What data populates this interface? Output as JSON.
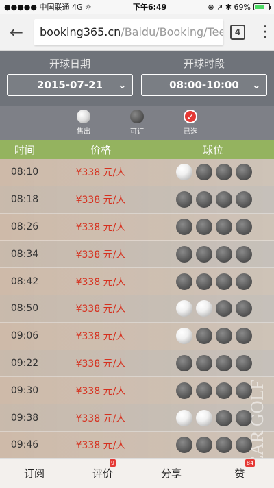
{
  "status": {
    "carrier": "●●●●● 中国联通  4G  ☼",
    "time": "下午6:49",
    "right": "⊕ ↗ ✱ 69%"
  },
  "browser": {
    "url_host": "booking365.cn",
    "url_path": "/Baidu/Booking/Tee",
    "tab_count": "4"
  },
  "filters": {
    "date_label": "开球日期",
    "date_value": "2015-07-21",
    "time_label": "开球时段",
    "time_value": "08:00-10:00"
  },
  "legend": {
    "sold": "售出",
    "available": "可订",
    "selected": "已选"
  },
  "table": {
    "headers": [
      "时间",
      "价格",
      "球位"
    ],
    "rows": [
      {
        "time": "08:10",
        "price": "¥338 元/人",
        "slots": [
          "sold",
          "avail",
          "avail",
          "avail"
        ]
      },
      {
        "time": "08:18",
        "price": "¥338 元/人",
        "slots": [
          "avail",
          "avail",
          "avail",
          "avail"
        ]
      },
      {
        "time": "08:26",
        "price": "¥338 元/人",
        "slots": [
          "avail",
          "avail",
          "avail",
          "avail"
        ]
      },
      {
        "time": "08:34",
        "price": "¥338 元/人",
        "slots": [
          "avail",
          "avail",
          "avail",
          "avail"
        ]
      },
      {
        "time": "08:42",
        "price": "¥338 元/人",
        "slots": [
          "avail",
          "avail",
          "avail",
          "avail"
        ]
      },
      {
        "time": "08:50",
        "price": "¥338 元/人",
        "slots": [
          "sold",
          "sold",
          "avail",
          "avail"
        ]
      },
      {
        "time": "09:06",
        "price": "¥338 元/人",
        "slots": [
          "sold",
          "avail",
          "avail",
          "avail"
        ]
      },
      {
        "time": "09:22",
        "price": "¥338 元/人",
        "slots": [
          "avail",
          "avail",
          "avail",
          "avail"
        ]
      },
      {
        "time": "09:30",
        "price": "¥338 元/人",
        "slots": [
          "avail",
          "avail",
          "avail",
          "avail"
        ]
      },
      {
        "time": "09:38",
        "price": "¥338 元/人",
        "slots": [
          "sold",
          "sold",
          "avail",
          "avail"
        ]
      },
      {
        "time": "09:46",
        "price": "¥338 元/人",
        "slots": [
          "avail",
          "avail",
          "avail",
          "avail"
        ]
      }
    ]
  },
  "bottom": {
    "subscribe": "订阅",
    "review": "评价",
    "review_badge": "9",
    "share": "分享",
    "like": "赞",
    "like_badge": "84"
  },
  "watermark": "PEAR GOLF",
  "colors": {
    "price": "#d6301e",
    "header": "#94b35f",
    "selected": "#e53935"
  }
}
